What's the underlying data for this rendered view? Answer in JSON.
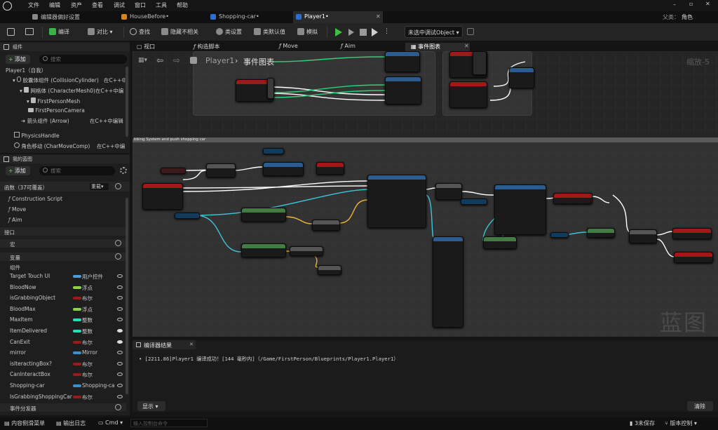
{
  "menu": {
    "items": [
      "文件",
      "编辑",
      "资产",
      "查看",
      "调试",
      "窗口",
      "工具",
      "帮助"
    ]
  },
  "tabs": [
    {
      "label": "编辑器偏好设置"
    },
    {
      "label": "HouseBefore•"
    },
    {
      "label": "Shopping-car•"
    },
    {
      "label": "Player1•"
    }
  ],
  "parent": {
    "label": "父类：",
    "value": "角色"
  },
  "toolbar": {
    "compile": "编译",
    "diff": "对比",
    "find": "查找",
    "hide": "隐藏不相关",
    "class_settings": "类设置",
    "class_defaults": "类默认值",
    "simulate": "模拟",
    "debug_object": "未选中调试Object"
  },
  "components": {
    "title": "组件",
    "add": "添加",
    "search_placeholder": "搜索",
    "tree": [
      {
        "label": "Player1（自我）"
      },
      {
        "label": "胶囊体组件 (CollisionCylinder)",
        "note": "在C++中"
      },
      {
        "label": "网格体 (CharacterMesh0)",
        "note": "在C++中编"
      },
      {
        "label": "FirstPersonMesh"
      },
      {
        "label": "FirstPersonCamera"
      },
      {
        "label": "箭头组件 (Arrow)",
        "note": "在C++中编辑"
      },
      {
        "label": "PhysicsHandle"
      },
      {
        "label": "角色移动 (CharMoveComp)",
        "note": "在C++中编"
      }
    ]
  },
  "mybp": {
    "title": "我的蓝图",
    "add": "添加",
    "search_placeholder": "搜索",
    "functions_header": "函数（37可覆盖）",
    "override": "重载",
    "functions": [
      "Construction Script",
      "Move",
      "Aim"
    ],
    "interfaces": "接口",
    "macros": "宏",
    "variables_header": "变量",
    "components_cat": "组件",
    "variables": [
      {
        "name": "Target Touch UI",
        "type": "用户控件",
        "color": "#4c9bd8"
      },
      {
        "name": "BloodNow",
        "type": "浮点",
        "color": "#8fd24a"
      },
      {
        "name": "isGrabbingObject",
        "type": "布尔",
        "color": "#a0191a"
      },
      {
        "name": "BloodMax",
        "type": "浮点",
        "color": "#8fd24a"
      },
      {
        "name": "MaxItem",
        "type": "整数",
        "color": "#1fe0b6"
      },
      {
        "name": "ItemDelivered",
        "type": "整数",
        "color": "#1fe0b6"
      },
      {
        "name": "CanExit",
        "type": "布尔",
        "color": "#a0191a"
      },
      {
        "name": "mirror",
        "type": "Mirror",
        "color": "#3a8fd0"
      },
      {
        "name": "isIteractingBox?",
        "type": "布尔",
        "color": "#a0191a"
      },
      {
        "name": "CanInteractBox",
        "type": "布尔",
        "color": "#a0191a"
      },
      {
        "name": "Shopping-car",
        "type": "Shopping-ca",
        "color": "#3a8fd0"
      },
      {
        "name": "IsGrabbingShoppingCar",
        "type": "布尔",
        "color": "#a0191a"
      }
    ],
    "dispatchers": "事件分发器"
  },
  "graph_tabs": [
    "视口",
    "构造脚本",
    "Move",
    "Aim",
    "事件图表"
  ],
  "breadcrumb": {
    "root": "Player1",
    "current": "事件图表"
  },
  "zoom": "缩放-5",
  "comment": "bbing System and push shopping car",
  "watermark": "蓝图",
  "compiler": {
    "title": "编译器结果",
    "line": "[2211.86]Player1 编译成功！[144 毫秒内]（/Game/FirstPerson/Blueprints/Player1.Player1）",
    "show": "显示",
    "clear": "清除"
  },
  "status": {
    "drawer": "内容侧滑菜单",
    "output": "输出日志",
    "cmd": "Cmd",
    "console_placeholder": "输入控制台命令",
    "unsaved": "3未保存",
    "vcs": "版本控制"
  }
}
